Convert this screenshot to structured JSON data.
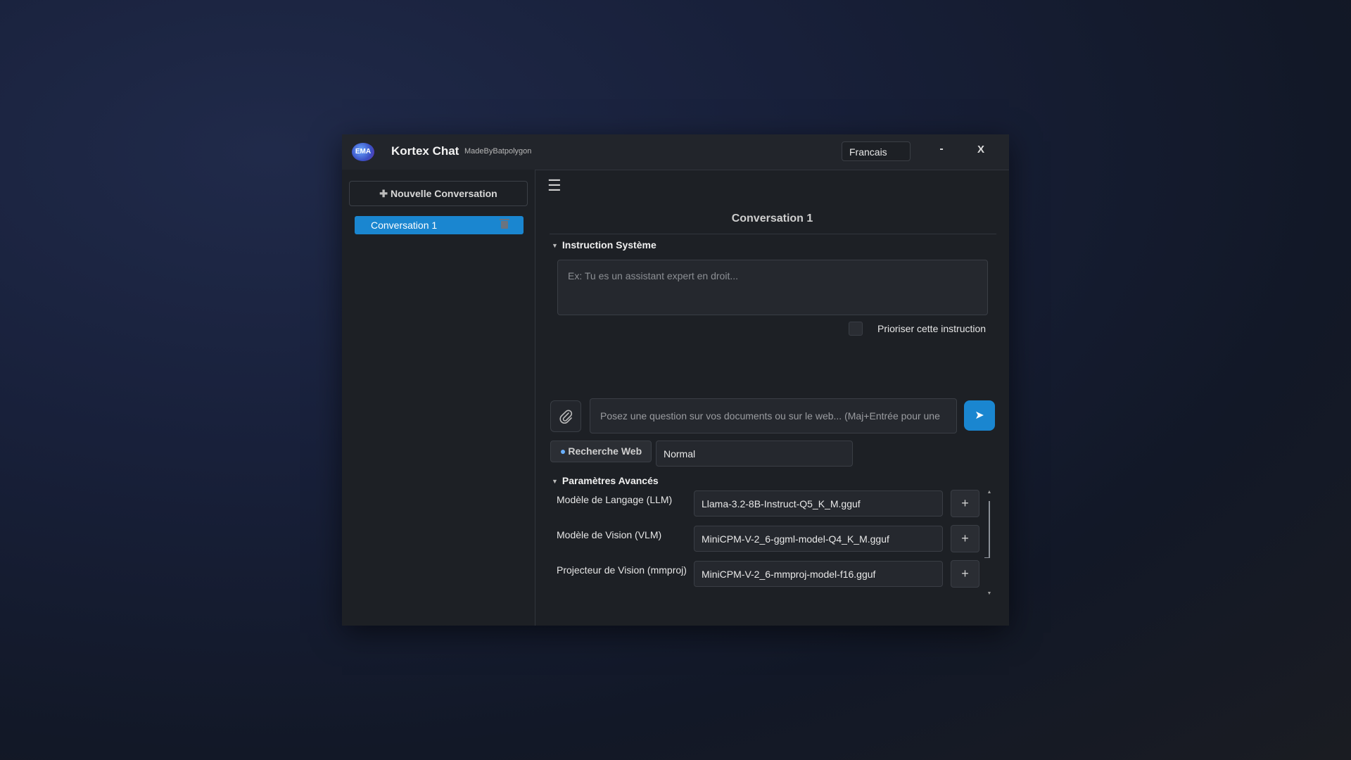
{
  "window": {
    "logo_text": "EMA",
    "app_title": "Kortex Chat",
    "made_by": "MadeByBatpolygon",
    "language": "Francais",
    "minimize_label": "-",
    "close_label": "X"
  },
  "sidebar": {
    "new_conversation_label": "Nouvelle Conversation",
    "conversations": [
      {
        "label": "Conversation 1",
        "active": true
      }
    ]
  },
  "main": {
    "menu_icon": "☰",
    "conversation_title": "Conversation 1",
    "system_instruction": {
      "header": "Instruction Système",
      "placeholder": "Ex: Tu es un assistant expert en droit...",
      "prioritize_label": "Prioriser cette instruction",
      "prioritize_checked": false
    },
    "composer": {
      "placeholder": "Posez une question sur vos documents ou sur le web... (Maj+Entrée pour une",
      "attach_icon": "paperclip-icon",
      "send_icon": "send-icon"
    },
    "web_search_label": "Recherche Web",
    "mode_value": "Normal",
    "advanced": {
      "header": "Paramètres Avancés",
      "models": [
        {
          "label": "Modèle de Langage (LLM)",
          "value": "Llama-3.2-8B-Instruct-Q5_K_M.gguf",
          "button": "+"
        },
        {
          "label": "Modèle de Vision (VLM)",
          "value": "MiniCPM-V-2_6-ggml-model-Q4_K_M.gguf",
          "button": "+"
        },
        {
          "label": "Projecteur de Vision (mmproj)",
          "value": "MiniCPM-V-2_6-mmproj-model-f16.gguf",
          "button": "+"
        }
      ]
    }
  },
  "colors": {
    "accent": "#1a86d0",
    "panel": "#1d2025",
    "field": "#25282e"
  }
}
